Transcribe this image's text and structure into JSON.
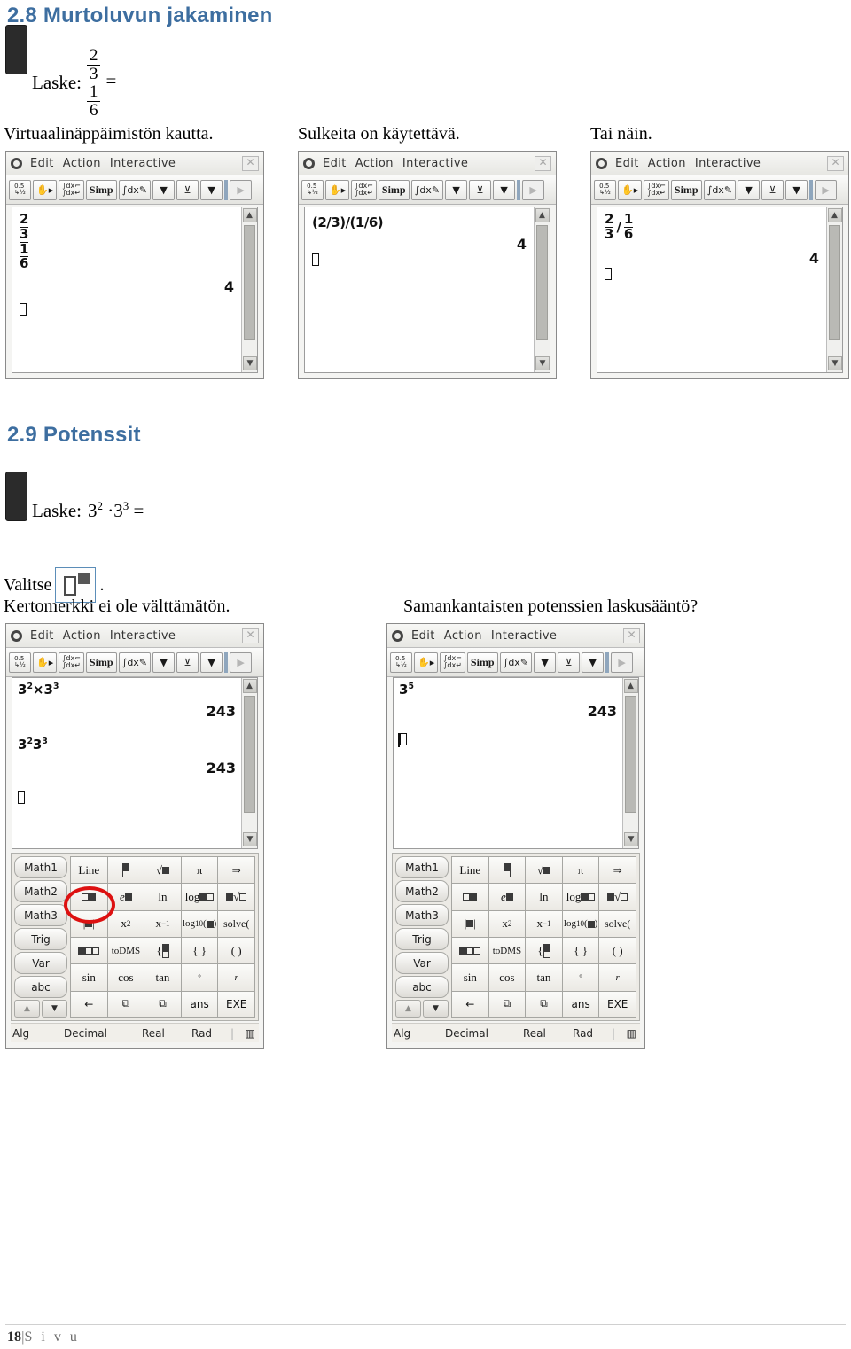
{
  "page": {
    "footer_number": "18",
    "footer_separator": "|",
    "footer_label": "S i v u",
    "heading_color": "#3d6ea0"
  },
  "section_28": {
    "heading": "2.8 Murtoluvun jakaminen",
    "task_label": "Laske:",
    "task_numerator_top": "2",
    "task_numerator_bottom": "3",
    "task_denominator_top": "1",
    "task_denominator_bottom": "6",
    "task_equals": "=",
    "captions": [
      "Virtuaalinäppäimistön kautta.",
      "Sulkeita on käytettävä.",
      "Tai näin."
    ]
  },
  "section_29": {
    "heading": "2.9 Potenssit",
    "task_label": "Laske:",
    "task_expression": "3² · 3³ =",
    "task_base": "3",
    "task_exp1": "2",
    "task_dot": "·",
    "task_exp2": "3",
    "task_equals": "=",
    "select_label": "Valitse",
    "select_period": ".",
    "captions": [
      "Kertomerkki ei ole välttämätön.",
      "Samankantaisten potenssien laskusääntö?"
    ]
  },
  "calculator": {
    "titlebar": {
      "gear_icon": "gear-icon",
      "menus": [
        "Edit",
        "Action",
        "Interactive"
      ],
      "close_icon": "close-icon"
    },
    "toolbar": {
      "buttons": [
        {
          "name": "decimal-fraction-toggle",
          "label": "0.5 1/2"
        },
        {
          "name": "hand-select",
          "label": "hand"
        },
        {
          "name": "integral-wrap",
          "label": "∫dx"
        },
        {
          "name": "simplify",
          "label": "Simp"
        },
        {
          "name": "integral-edit",
          "label": "∫dx"
        },
        {
          "name": "dropdown-1",
          "label": "▼"
        },
        {
          "name": "graph",
          "label": "graph"
        },
        {
          "name": "dropdown-2",
          "label": "▼"
        },
        {
          "name": "next-page",
          "label": "▶"
        }
      ]
    },
    "scrollbar": {
      "up": "▲",
      "down": "▼"
    }
  },
  "screens": [
    {
      "id": "screen-1",
      "caption": "Virtuaalinäppäimistön kautta.",
      "entry_type": "stacked-fraction",
      "entry": {
        "num_top": "2",
        "num_bottom": "3",
        "den_top": "1",
        "den_bottom": "6"
      },
      "result": "4",
      "keyboard": false
    },
    {
      "id": "screen-2",
      "caption": "Sulkeita on käytettävä.",
      "entry_type": "text",
      "entry": "(2/3)/(1/6)",
      "result": "4",
      "keyboard": false
    },
    {
      "id": "screen-3",
      "caption": "Tai näin.",
      "entry_type": "inline-fractions",
      "entry": {
        "a_top": "2",
        "a_bottom": "3",
        "slash": "/",
        "b_top": "1",
        "b_bottom": "6"
      },
      "result": "4",
      "keyboard": false
    },
    {
      "id": "screen-4",
      "caption": "Kertomerkki ei ole välttämätön.",
      "entry_type": "powers",
      "lines": [
        {
          "expr": "3²×3³",
          "base1": "3",
          "exp1": "2",
          "op": "×",
          "base2": "3",
          "exp2": "3",
          "result": "243"
        },
        {
          "expr": "3²3³",
          "base1": "3",
          "exp1": "2",
          "op": "",
          "base2": "3",
          "exp2": "3",
          "result": "243"
        }
      ],
      "keyboard": true,
      "highlight": "power-key"
    },
    {
      "id": "screen-5",
      "caption": "Samankantaisten potenssien laskusääntö?",
      "entry_type": "power",
      "lines": [
        {
          "base1": "3",
          "exp1": "5",
          "result": "243"
        }
      ],
      "keyboard": true,
      "highlight": null
    }
  ],
  "keyboard": {
    "tabs": [
      "Math1",
      "Math2",
      "Math3",
      "Trig",
      "Var",
      "abc"
    ],
    "nav": [
      "▲",
      "▼"
    ],
    "rows": [
      [
        "Line",
        "fraction",
        "√■",
        "π",
        "⇒"
      ],
      [
        "□■",
        "e■",
        "ln",
        "log■□",
        "■√□"
      ],
      [
        "|■|",
        "x²",
        "x⁻¹",
        "log₁₀(■)",
        "solve("
      ],
      [
        "■□□",
        "toDMS",
        "{fraction",
        "{ }",
        "( )"
      ],
      [
        "sin",
        "cos",
        "tan",
        "°",
        "r"
      ],
      [
        "←",
        "copy",
        "paste",
        "ans",
        "EXE"
      ]
    ],
    "status": [
      "Alg",
      "Decimal",
      "Real",
      "Rad",
      "battery-icon"
    ]
  }
}
